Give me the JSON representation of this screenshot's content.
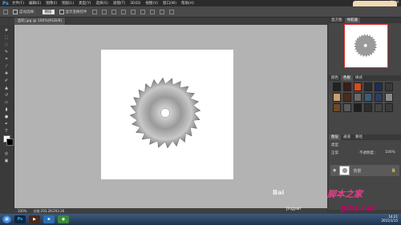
{
  "app": {
    "logo": "Ps"
  },
  "menu": [
    "文件(F)",
    "编辑(E)",
    "图像(I)",
    "图层(L)",
    "类型(Y)",
    "选择(S)",
    "滤镜(T)",
    "3D(D)",
    "视图(V)",
    "窗口(W)",
    "帮助(H)"
  ],
  "window_controls": [
    "–",
    "□",
    "×"
  ],
  "options": {
    "auto_select_label": "自动选择：",
    "auto_select_value": "图层",
    "show_transform_label": "显示变换控件"
  },
  "tab": {
    "name": "齿轮.jpg @ 100%(RGB/8)"
  },
  "status": {
    "zoom": "100%",
    "doc": "文档:293.2K/293.2K"
  },
  "panels": {
    "navigator_tabs": [
      "直方图",
      "导航器"
    ],
    "swatch_tabs": [
      "颜色",
      "色板",
      "样式"
    ],
    "layer_tabs": [
      "图层",
      "通道",
      "路径"
    ],
    "layer_kind": "类型",
    "layer_mode": "正常",
    "opacity_label": "不透明度：",
    "opacity_value": "100%",
    "layer_name": "背景"
  },
  "swatch_colors": [
    "#222222",
    "#3a1d18",
    "#d94a1c",
    "#2a2a2a",
    "#1c2f55",
    "#3a3a3a",
    "#caa06a",
    "#4a2d1b",
    "#6a6a6a",
    "#3f5b7a",
    "#2d3e63",
    "#8a8a8a",
    "#6d4a28",
    "#5a5a5a",
    "#1e1e1e",
    "#2e2e2e",
    "#444444",
    "#3b3b3b"
  ],
  "taskbar": {
    "clock_time": "14:21",
    "clock_date": "2015/1/15"
  },
  "watermark": {
    "text": "Bai",
    "brand": "脚本之家",
    "url_left": "jingyan",
    "url_right": "JB51.net"
  },
  "notification": "点击此处"
}
